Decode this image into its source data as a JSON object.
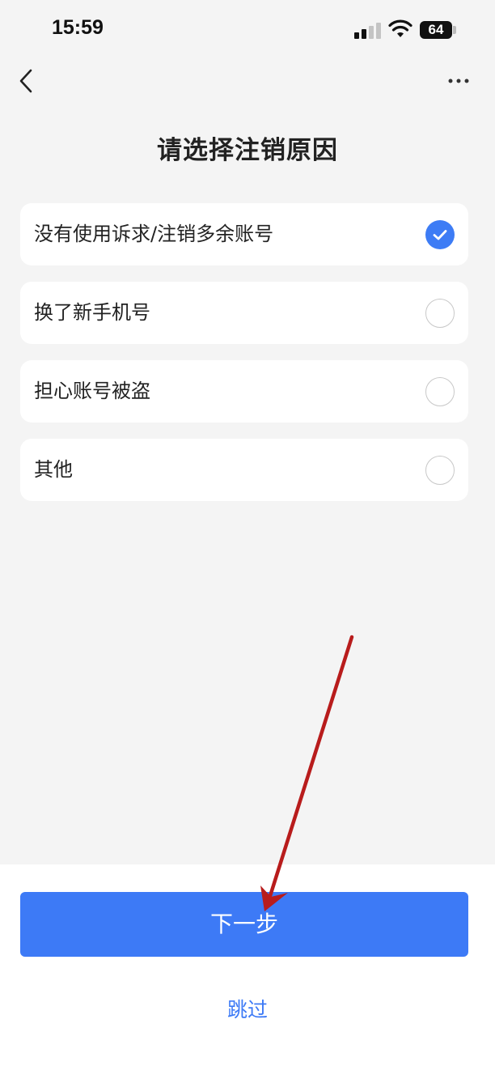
{
  "status_bar": {
    "time": "15:59",
    "battery": "64",
    "icons": [
      "signal-icon",
      "wifi-icon",
      "battery-icon"
    ]
  },
  "nav": {
    "back_icon": "chevron-left-icon",
    "more_icon": "more-horizontal-icon"
  },
  "page": {
    "title": "请选择注销原因"
  },
  "options": [
    {
      "label": "没有使用诉求/注销多余账号",
      "checked": true
    },
    {
      "label": "换了新手机号",
      "checked": false
    },
    {
      "label": "担心账号被盗",
      "checked": false
    },
    {
      "label": "其他",
      "checked": false
    }
  ],
  "actions": {
    "next_label": "下一步",
    "skip_label": "跳过"
  },
  "colors": {
    "accent": "#3d7af6",
    "background": "#f4f4f4",
    "card": "#ffffff",
    "annotation_arrow": "#b81c1c"
  }
}
